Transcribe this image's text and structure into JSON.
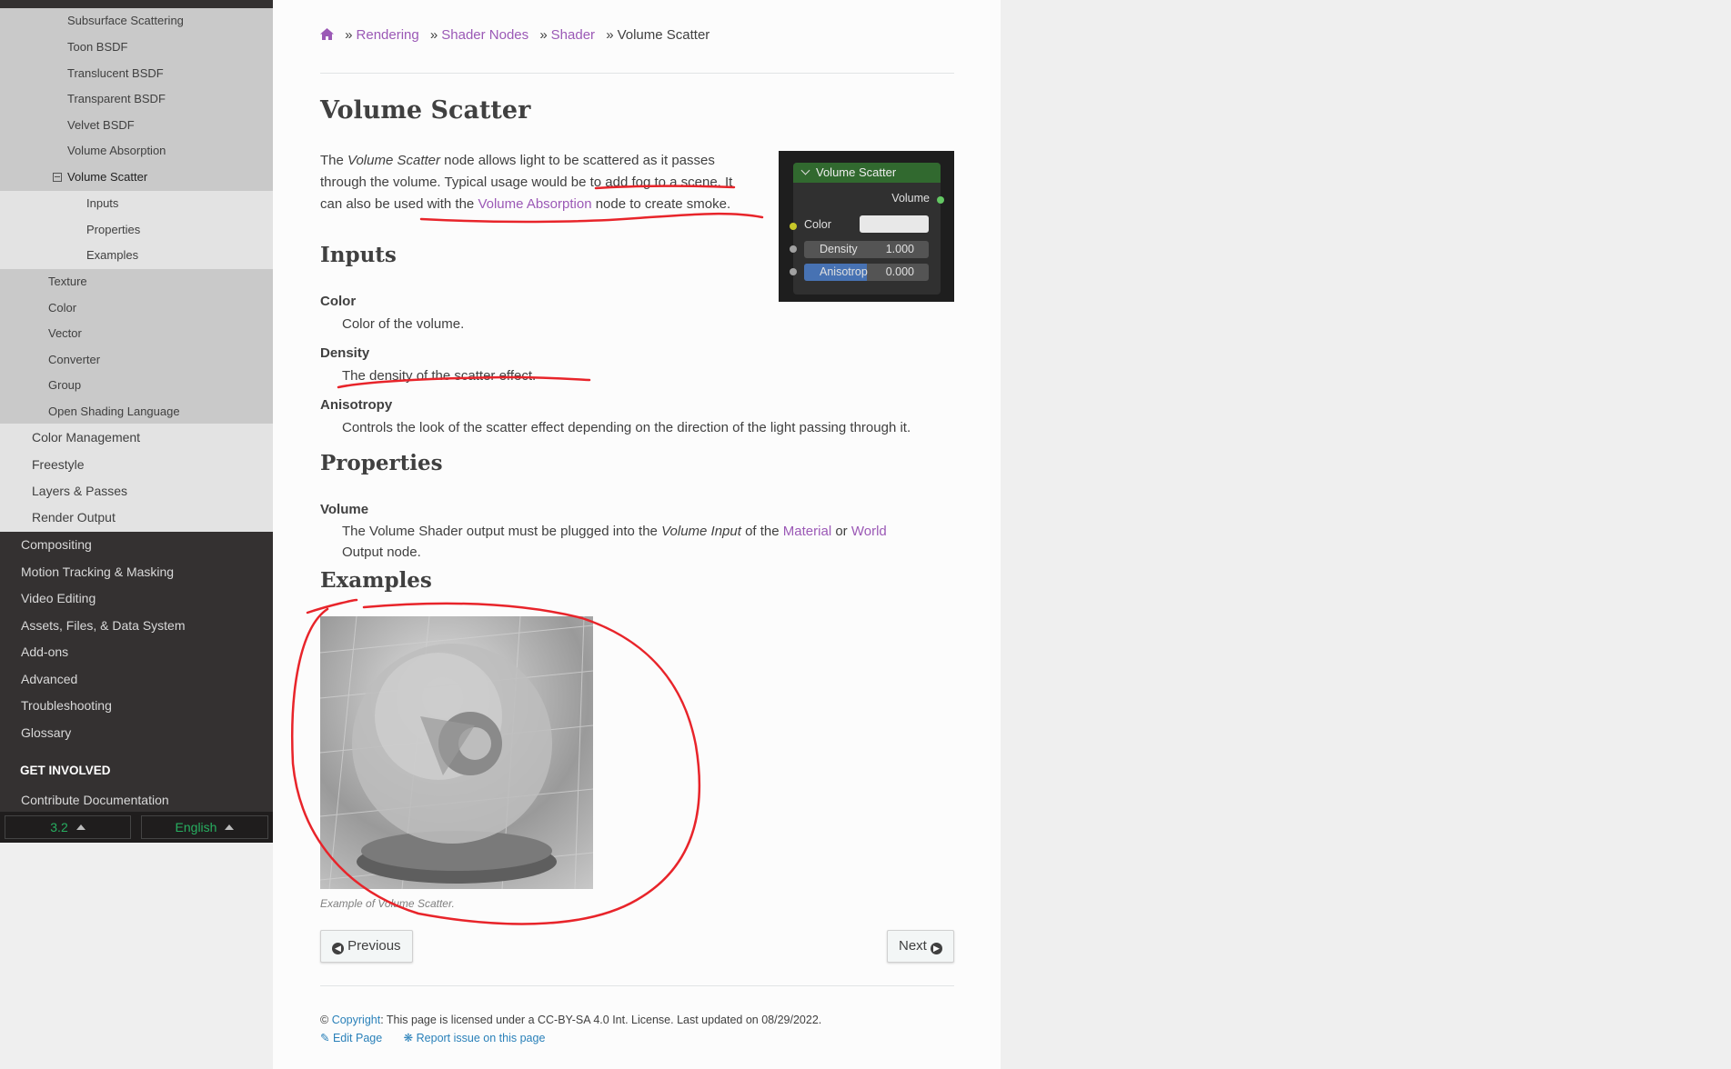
{
  "sidebar": {
    "level3_before": [
      "Subsurface Scattering",
      "Toon BSDF",
      "Translucent BSDF",
      "Transparent BSDF",
      "Velvet BSDF",
      "Volume Absorption"
    ],
    "current": "Volume Scatter",
    "level4": [
      "Inputs",
      "Properties",
      "Examples"
    ],
    "level3_after": [
      "Texture",
      "Color",
      "Vector",
      "Converter",
      "Group",
      "Open Shading Language"
    ],
    "level2": [
      "Color Management",
      "Freestyle",
      "Layers & Passes",
      "Render Output"
    ],
    "level1": [
      "Compositing",
      "Motion Tracking & Masking",
      "Video Editing",
      "Assets, Files, & Data System",
      "Add-ons",
      "Advanced",
      "Troubleshooting",
      "Glossary"
    ],
    "caption": "GET INVOLVED",
    "contribute": "Contribute Documentation",
    "version": "3.2",
    "language": "English"
  },
  "breadcrumb": {
    "items": [
      "Rendering",
      "Shader Nodes",
      "Shader"
    ],
    "current": "Volume Scatter",
    "sep": "»"
  },
  "page": {
    "title": "Volume Scatter",
    "intro": {
      "p1": "The ",
      "em": "Volume Scatter",
      "p2": " node allows light to be scattered as it passes through the volume. Typical usage would be to add fog to a scene. It can also be used with the ",
      "link": "Volume Absorption",
      "p3": " node to create smoke."
    },
    "inputs_heading": "Inputs",
    "inputs": [
      {
        "term": "Color",
        "desc": "Color of the volume."
      },
      {
        "term": "Density",
        "desc": "The density of the scatter effect."
      },
      {
        "term": "Anisotropy",
        "desc": "Controls the look of the scatter effect depending on the direction of the light passing through it."
      }
    ],
    "properties_heading": "Properties",
    "properties": {
      "term": "Volume",
      "d1": "The Volume Shader output must be plugged into the ",
      "em": "Volume Input",
      "d2": " of the ",
      "link1": "Material",
      "d3": " or ",
      "link2": "World",
      "d4": " Output node."
    },
    "examples_heading": "Examples",
    "example_caption": "Example of Volume Scatter."
  },
  "node": {
    "title": "Volume Scatter",
    "output": "Volume",
    "color_label": "Color",
    "density_label": "Density",
    "density_value": "1.000",
    "anisotropy_label": "Anisotrop",
    "anisotropy_value": "0.000",
    "anisotropy_fill": 0.5,
    "colors": {
      "header": "#31692f",
      "socket_color": "#c7c729",
      "socket_value": "#a1a1a1",
      "socket_out": "#63c763",
      "aniso_fill": "#4772b3"
    }
  },
  "nav": {
    "previous": "Previous",
    "next": "Next"
  },
  "footer": {
    "copy_symbol": "©",
    "copyright_link": "Copyright",
    "license": ": This page is licensed under a CC-BY-SA 4.0 Int. License. Last updated on 08/29/2022.",
    "edit": "Edit Page",
    "report": "Report issue on this page"
  },
  "annotation_color": "#e8242a"
}
